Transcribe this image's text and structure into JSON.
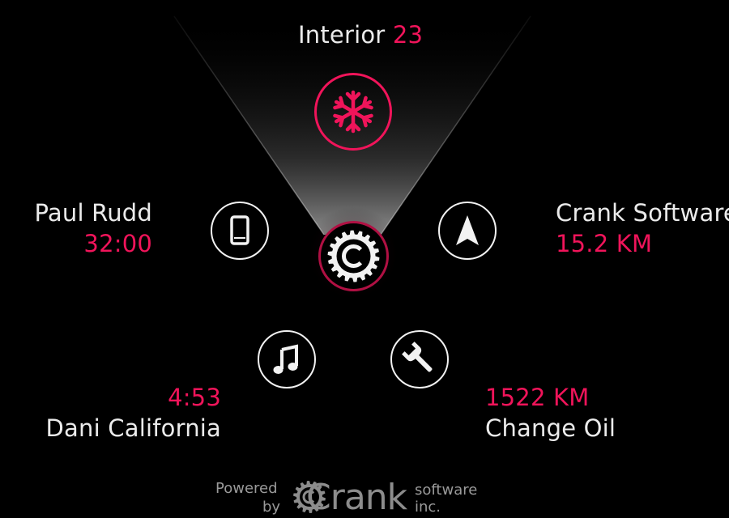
{
  "colors": {
    "background": "#000000",
    "accent": "#f0145a",
    "text": "#ebebeb",
    "muted": "#9a9a9a"
  },
  "climate": {
    "label": "Interior",
    "value": "23",
    "icon": "snowflake-icon"
  },
  "phone": {
    "name": "Paul Rudd",
    "duration": "32:00",
    "icon": "phone-icon"
  },
  "navigation": {
    "destination": "Crank Software",
    "distance": "15.2 KM",
    "icon": "navigation-arrow-icon"
  },
  "music": {
    "time": "4:53",
    "track": "Dani California",
    "icon": "music-note-icon"
  },
  "maintenance": {
    "distance": "1522 KM",
    "task": "Change Oil",
    "icon": "wrench-icon"
  },
  "hub": {
    "icon": "crank-logo-icon"
  },
  "footer": {
    "powered": "Powered",
    "by": "by",
    "brand": "Crank",
    "software": "software",
    "inc": "inc."
  }
}
